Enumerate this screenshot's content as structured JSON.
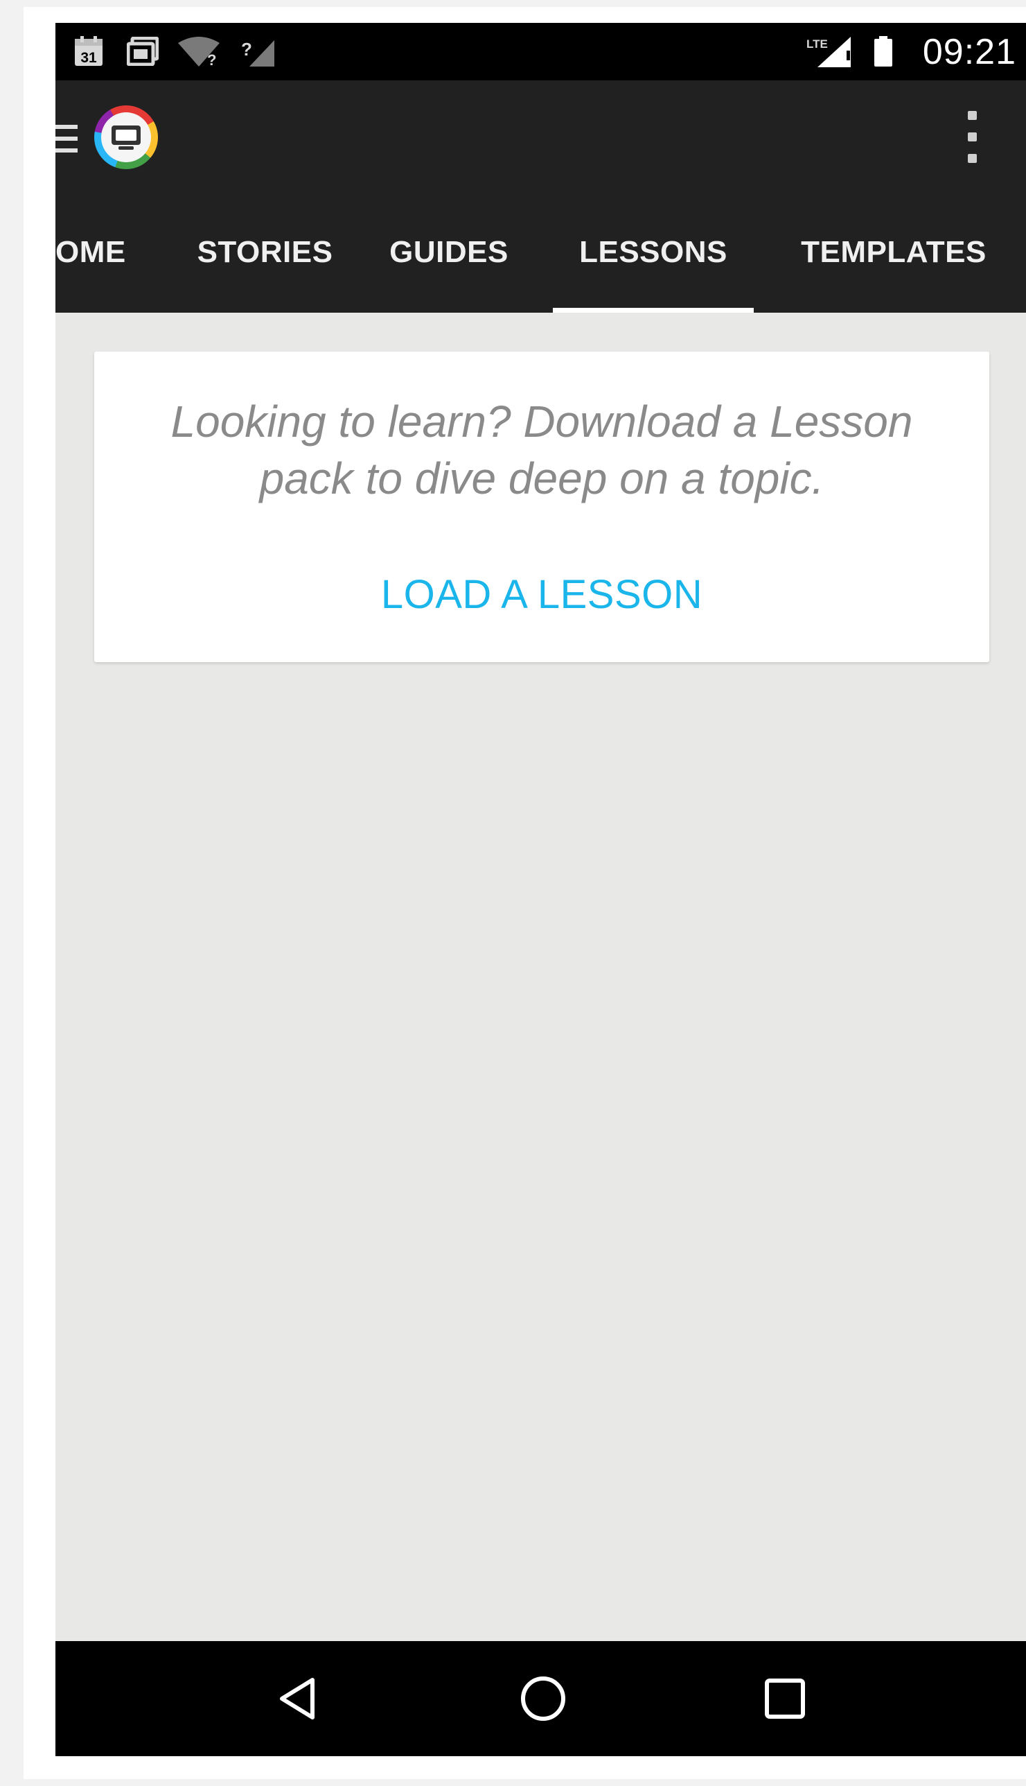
{
  "status_bar": {
    "time": "09:21",
    "icons": [
      "calendar-icon",
      "gallery-icon",
      "wifi-unknown-icon",
      "signal-unknown-icon",
      "lte-signal-icon",
      "battery-icon"
    ],
    "calendar_day": "31",
    "unknown_mark": "?",
    "lte_label": "LTE"
  },
  "app_bar": {
    "menu_icon": "hamburger-icon",
    "logo_icon": "app-logo-icon",
    "overflow_icon": "more-vert-icon"
  },
  "tabs": [
    {
      "label": "OME",
      "selected": false
    },
    {
      "label": "STORIES",
      "selected": false
    },
    {
      "label": "GUIDES",
      "selected": false
    },
    {
      "label": "LESSONS",
      "selected": true
    },
    {
      "label": "TEMPLATES",
      "selected": false
    }
  ],
  "card": {
    "message": "Looking to learn? Download a Lesson pack to dive deep on a topic.",
    "action_label": "LOAD A LESSON"
  },
  "nav_bar": {
    "icons": [
      "back-icon",
      "home-icon",
      "recents-icon"
    ]
  },
  "colors": {
    "status_bar": "#000000",
    "app_bar": "#212121",
    "content_bg": "#e8e9e7",
    "card_bg": "#ffffff",
    "accent": "#1ab5ea",
    "message_text": "#8a8a8a",
    "tab_text": "#f0f0f0"
  }
}
